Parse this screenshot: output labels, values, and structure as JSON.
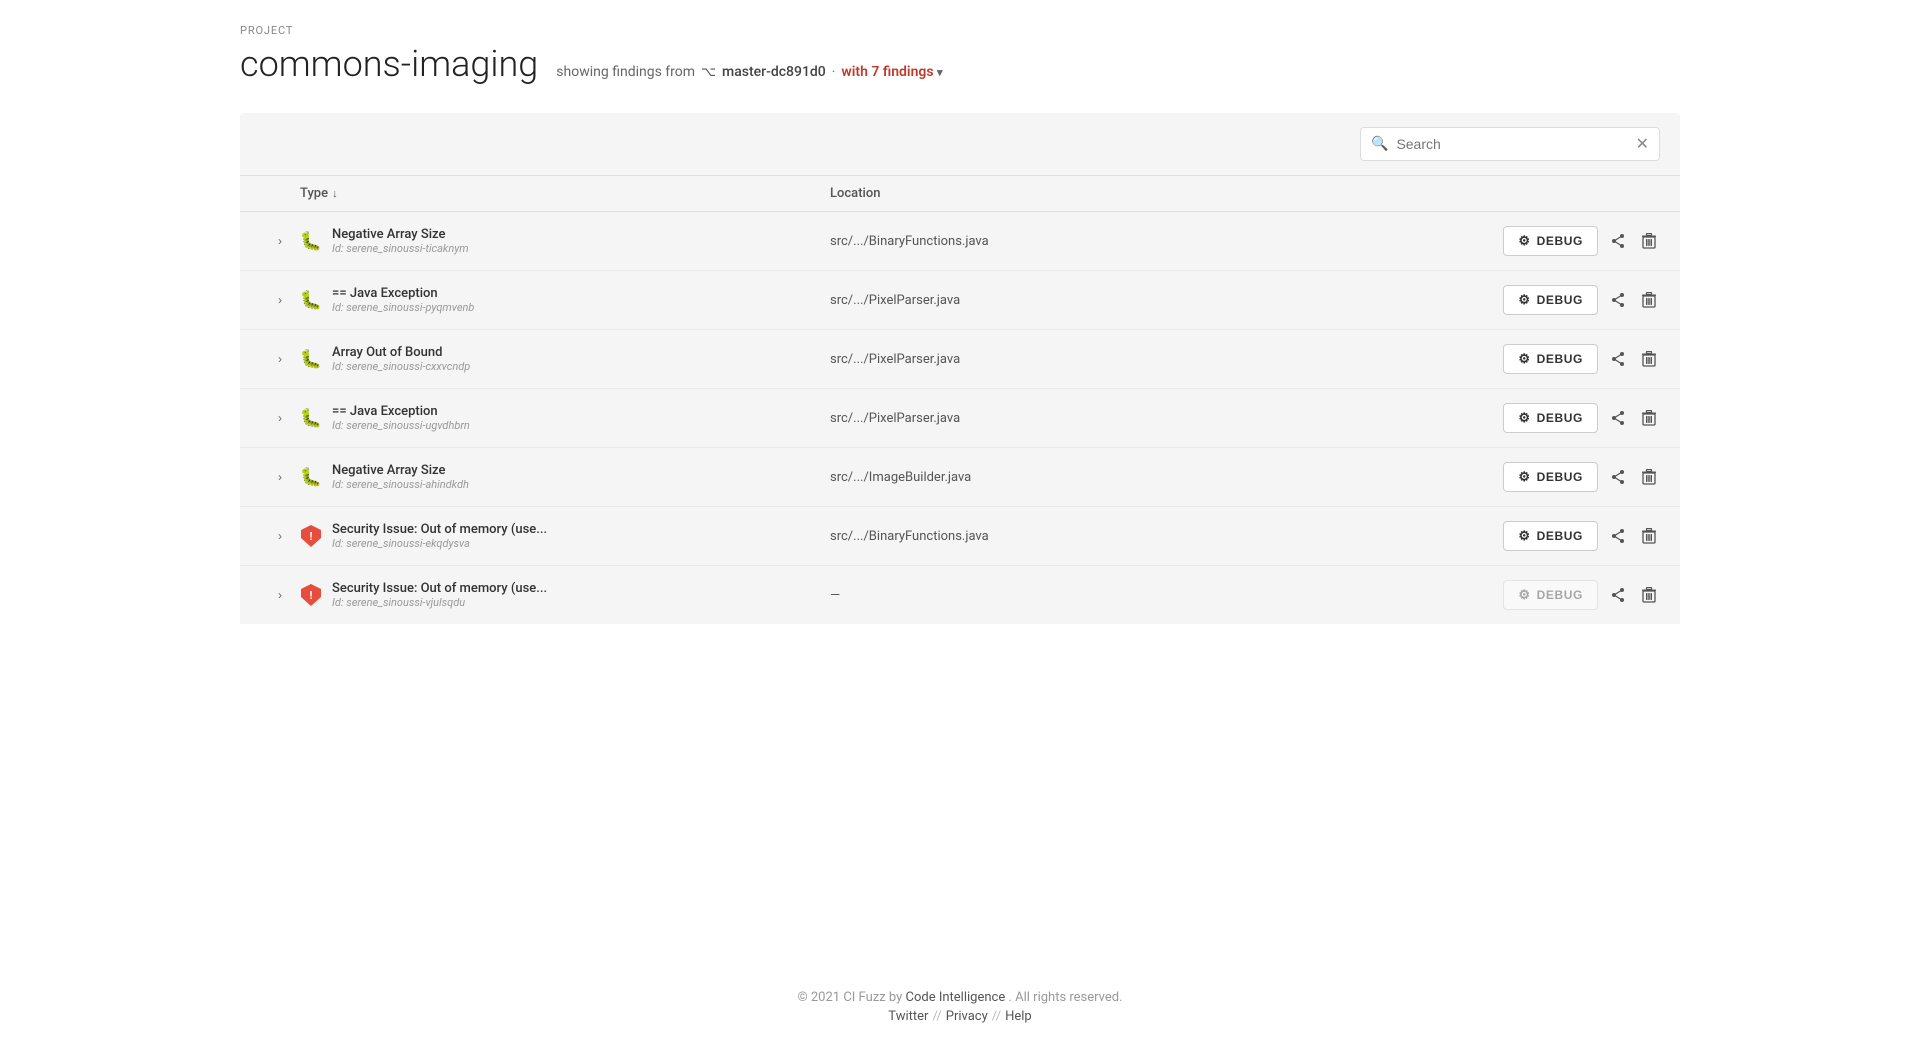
{
  "project": {
    "label": "PROJECT",
    "title": "commons-imaging",
    "subtitle": {
      "showing": "showing findings from",
      "branch": "master-dc891d0",
      "findings_text": "with 7 findings"
    }
  },
  "search": {
    "placeholder": "Search",
    "value": ""
  },
  "table": {
    "columns": [
      {
        "id": "expand",
        "label": ""
      },
      {
        "id": "type",
        "label": "Type",
        "sortable": true
      },
      {
        "id": "location",
        "label": "Location",
        "sortable": false
      },
      {
        "id": "actions",
        "label": ""
      }
    ]
  },
  "findings": [
    {
      "id": 1,
      "type": "bug",
      "name": "Negative Array Size",
      "finding_id": "Id: serene_sinoussi-ticaknym",
      "location": "src/.../BinaryFunctions.java",
      "debug_enabled": true,
      "debug_label": "DEBUG"
    },
    {
      "id": 2,
      "type": "bug",
      "name": "== Java Exception",
      "finding_id": "Id: serene_sinoussi-pyqmvenb",
      "location": "src/.../PixelParser.java",
      "debug_enabled": true,
      "debug_label": "DEBUG"
    },
    {
      "id": 3,
      "type": "bug",
      "name": "Array Out of Bound",
      "finding_id": "Id: serene_sinoussi-cxxvcndp",
      "location": "src/.../PixelParser.java",
      "debug_enabled": true,
      "debug_label": "DEBUG"
    },
    {
      "id": 4,
      "type": "bug",
      "name": "== Java Exception",
      "finding_id": "Id: serene_sinoussi-ugvdhbrn",
      "location": "src/.../PixelParser.java",
      "debug_enabled": true,
      "debug_label": "DEBUG"
    },
    {
      "id": 5,
      "type": "bug",
      "name": "Negative Array Size",
      "finding_id": "Id: serene_sinoussi-ahindkdh",
      "location": "src/.../ImageBuilder.java",
      "debug_enabled": true,
      "debug_label": "DEBUG"
    },
    {
      "id": 6,
      "type": "security",
      "name": "Security Issue: Out of memory (use...",
      "finding_id": "Id: serene_sinoussi-ekqdysva",
      "location": "src/.../BinaryFunctions.java",
      "debug_enabled": true,
      "debug_label": "DEBUG"
    },
    {
      "id": 7,
      "type": "security",
      "name": "Security Issue: Out of memory (use...",
      "finding_id": "Id: serene_sinoussi-vjulsqdu",
      "location": "—",
      "debug_enabled": false,
      "debug_label": "DEBUG"
    }
  ],
  "footer": {
    "copyright": "© 2021 CI Fuzz by",
    "company": "Code Intelligence",
    "rights": ". All rights reserved.",
    "links": [
      {
        "label": "Twitter",
        "url": "#"
      },
      {
        "label": "Privacy",
        "url": "#"
      },
      {
        "label": "Help",
        "url": "#"
      }
    ]
  },
  "icons": {
    "search": "🔍",
    "gear": "⚙",
    "share": "⬆",
    "delete": "🗑",
    "chevron_right": "›",
    "sort_down": "↓",
    "branch": "⌥",
    "close": "✕"
  }
}
